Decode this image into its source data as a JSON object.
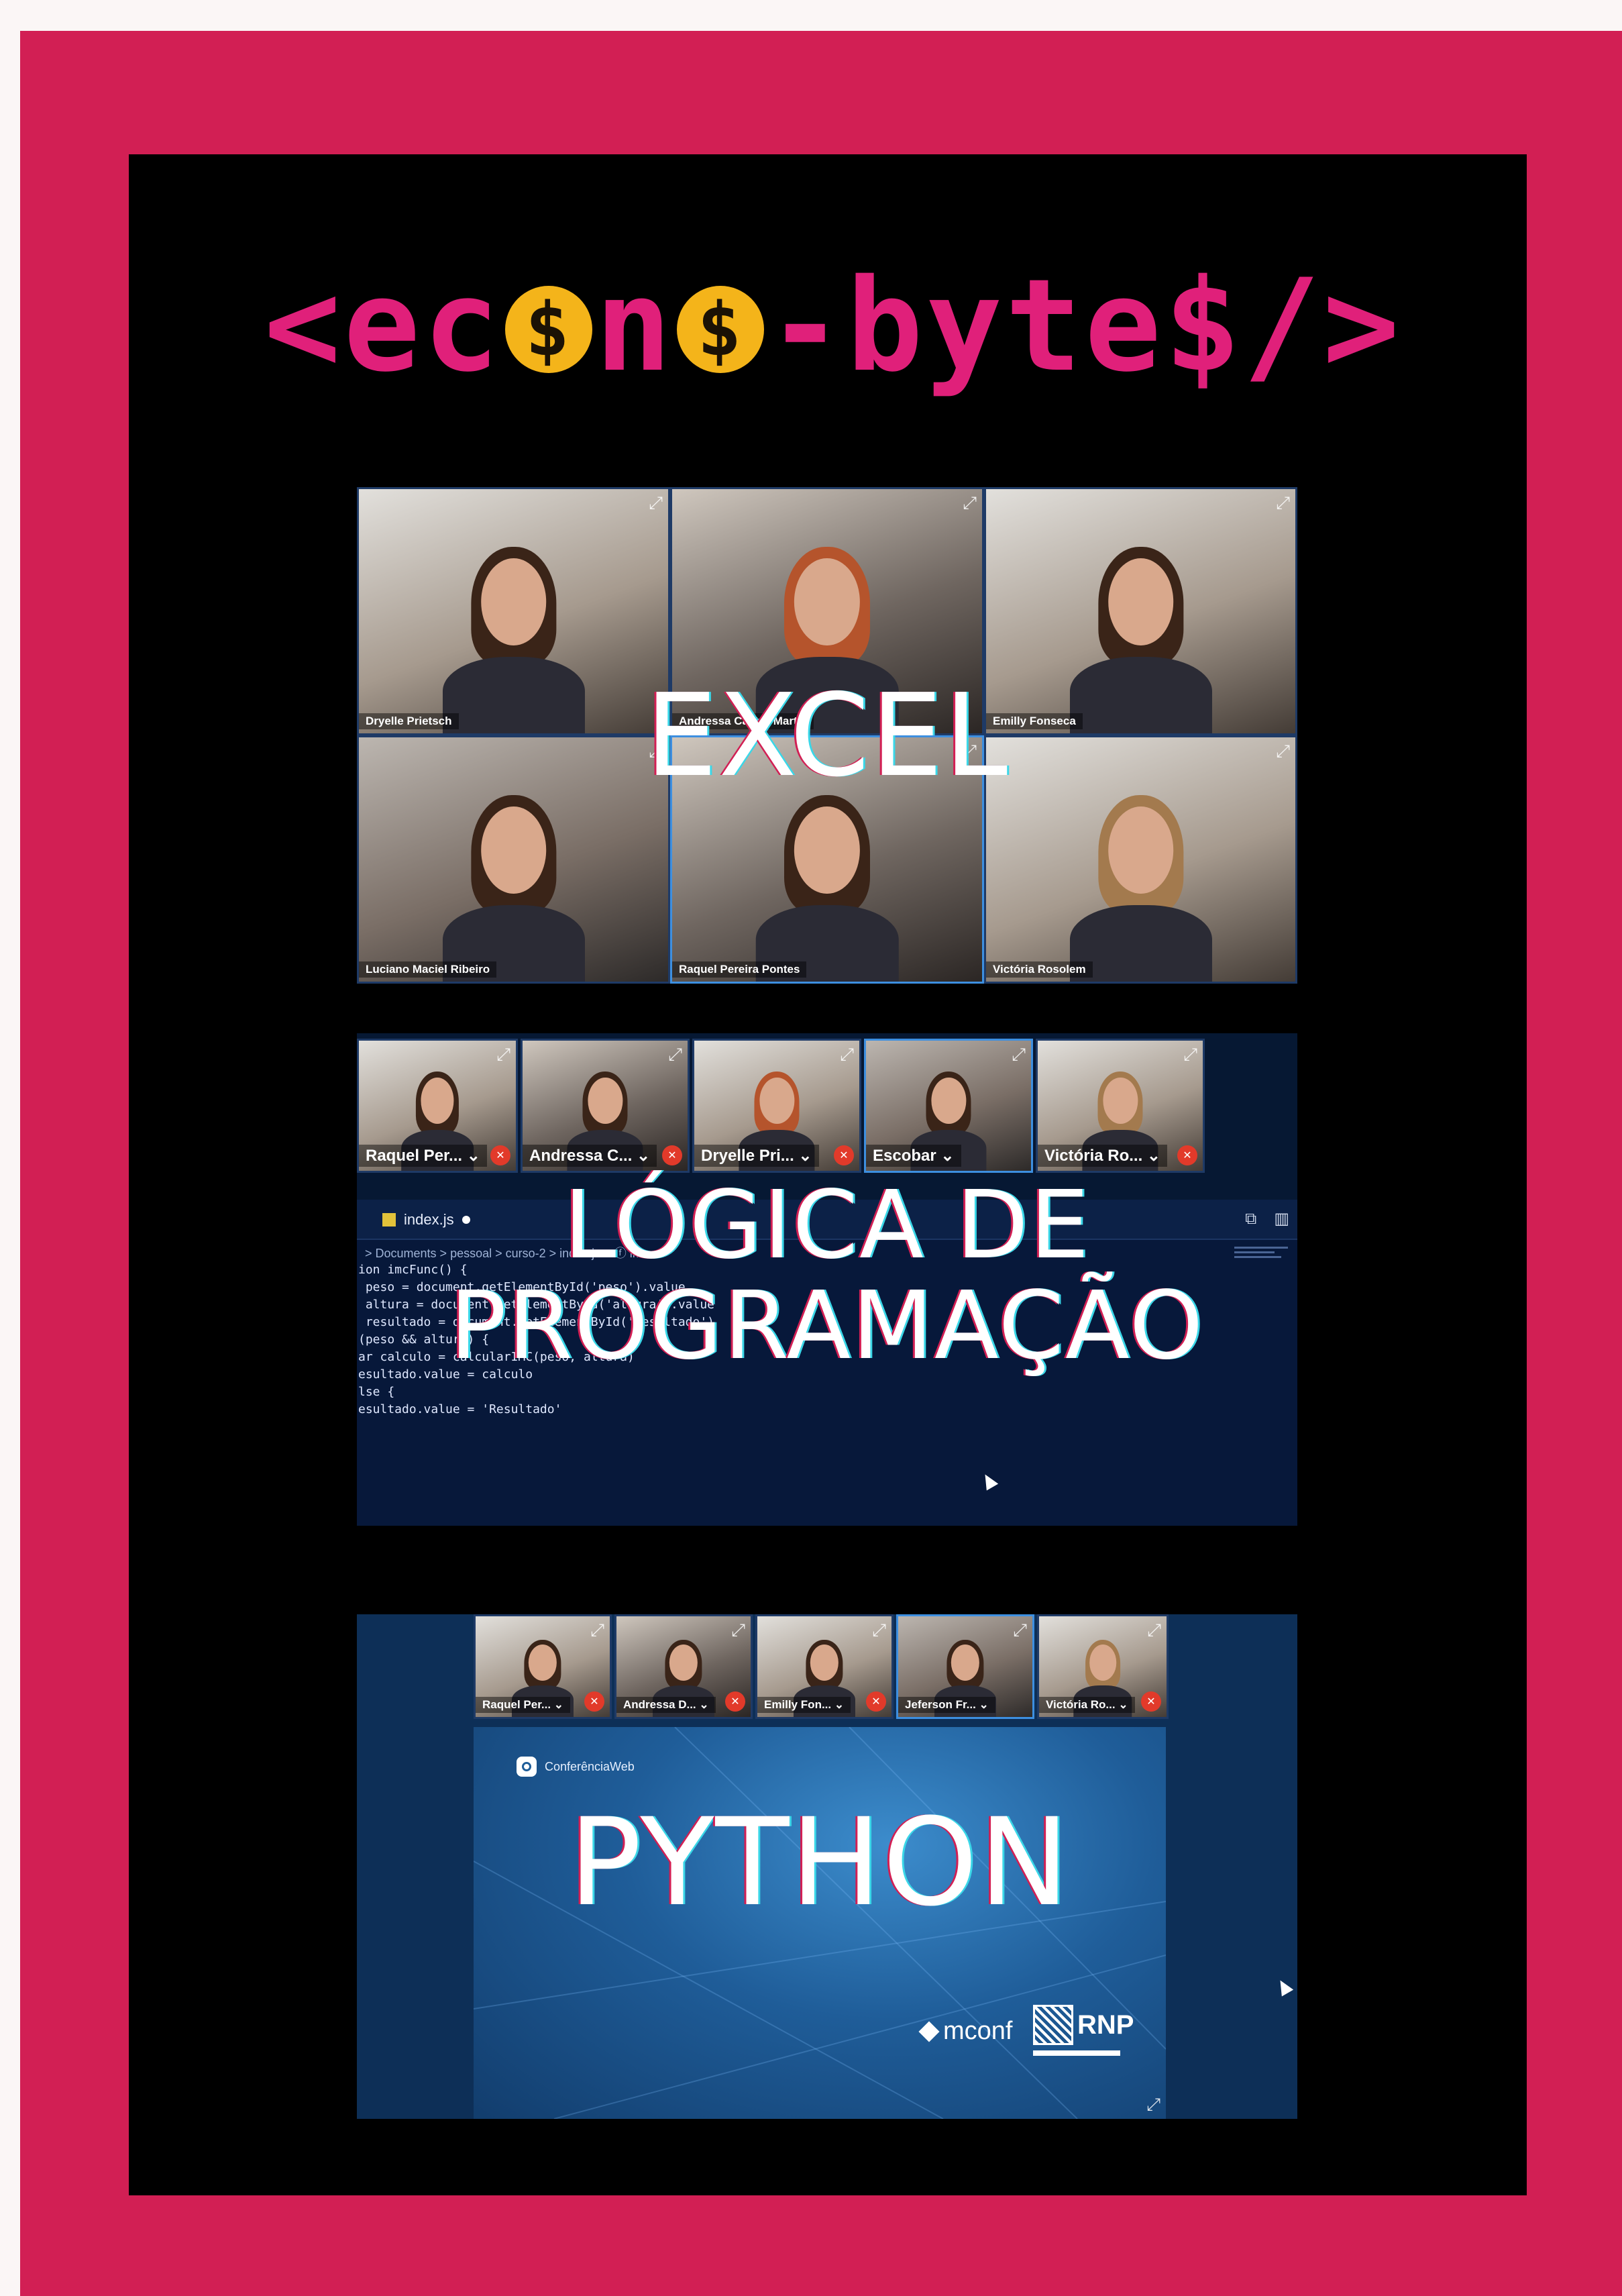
{
  "logo": {
    "before": "<ec",
    "coin1": "$",
    "middle": "n",
    "coin2": "$",
    "after": "-byte$/>"
  },
  "colors": {
    "frame": "#d21f54",
    "logo_text": "#e0207a",
    "coin": "#f4b41a",
    "panel": "#000000"
  },
  "excel": {
    "title": "EXCEL",
    "participants": [
      {
        "name": "Dryelle Prietsch",
        "indicator": "⌄"
      },
      {
        "name": "Andressa Castro Martel",
        "indicator": "⌄"
      },
      {
        "name": "Emilly Fonseca",
        "indicator": "⌄"
      },
      {
        "name": "Luciano Maciel Ribeiro",
        "indicator": "⌄"
      },
      {
        "name": "Raquel Pereira Pontes",
        "indicator": "⌄"
      },
      {
        "name": "Victória Rosolem",
        "indicator": "⌄"
      }
    ]
  },
  "logic": {
    "title_line1": "LÓGICA DE",
    "title_line2": "PROGRAMAÇÃO",
    "participants": [
      {
        "name": "Raquel Per... ⌄"
      },
      {
        "name": "Andressa C... ⌄"
      },
      {
        "name": "Dryelle Pri... ⌄"
      },
      {
        "name": "Escobar ⌄"
      },
      {
        "name": "Victória Ro... ⌄"
      }
    ],
    "editor": {
      "file_tab": "index.js",
      "breadcrumb": "> Documents > pessoal > curso-2 > index.js > ⓕ imc",
      "code_lines": [
        "ion imcFunc() {",
        " peso = document.getElementById('peso').value",
        " altura = document.getElementById('altura').value",
        " resultado = document.getElementById('resultado')",
        "(peso && altura) {",
        "ar calculo = calcularIMC(peso, altura)",
        "esultado.value = calculo",
        "lse {",
        "esultado.value = 'Resultado'"
      ]
    }
  },
  "python": {
    "title": "PYTHON",
    "participants": [
      {
        "name": "Raquel Per... ⌄"
      },
      {
        "name": "Andressa D... ⌄"
      },
      {
        "name": "Emilly Fon... ⌄"
      },
      {
        "name": "Jeferson Fr... ⌄"
      },
      {
        "name": "Victória Ro... ⌄"
      }
    ],
    "slide": {
      "brand": "ConferênciaWeb",
      "mconf": "mconf",
      "rnp": "RNP"
    }
  },
  "icons": {
    "expand": "expand-icon",
    "mute": "microphone-muted-icon",
    "cursor": "mouse-pointer-icon"
  }
}
